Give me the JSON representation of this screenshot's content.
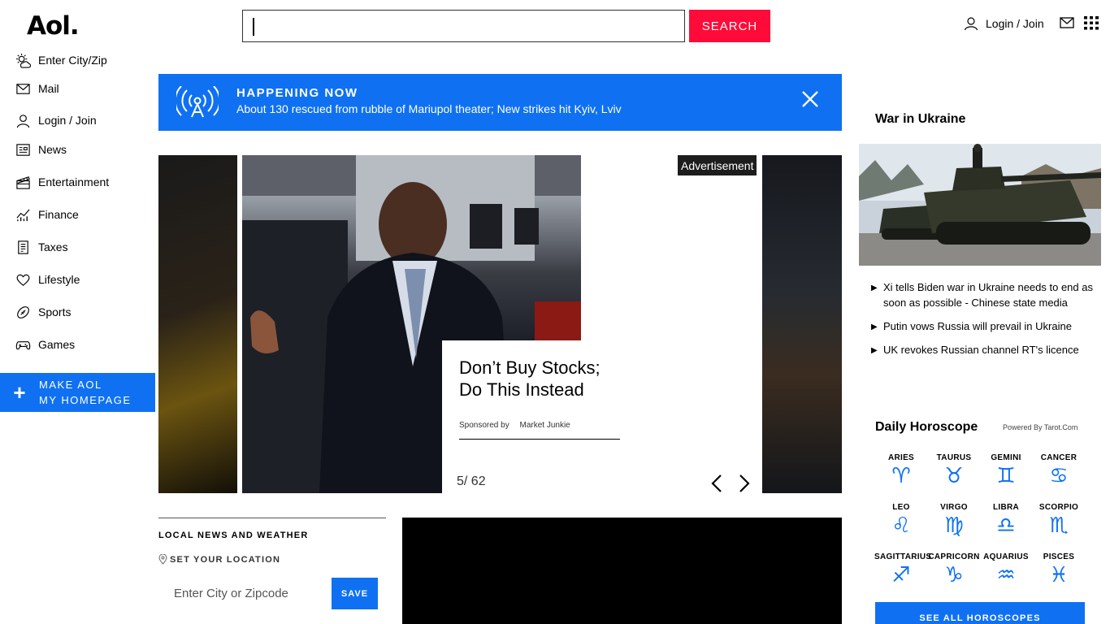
{
  "header": {
    "logo": "Aol.",
    "search_placeholder": "",
    "search_button": "SEARCH",
    "login_label": "Login / Join"
  },
  "nav": {
    "items": [
      {
        "label": "Enter City/Zip",
        "icon": "weather-icon"
      },
      {
        "label": "Mail",
        "icon": "mail-icon"
      },
      {
        "label": "Login / Join",
        "icon": "user-icon"
      },
      {
        "label": "News",
        "icon": "news-icon"
      },
      {
        "label": "Entertainment",
        "icon": "clapperboard-icon"
      },
      {
        "label": "Finance",
        "icon": "chart-icon"
      },
      {
        "label": "Taxes",
        "icon": "document-icon"
      },
      {
        "label": "Lifestyle",
        "icon": "heart-icon"
      },
      {
        "label": "Sports",
        "icon": "football-icon"
      },
      {
        "label": "Games",
        "icon": "gamepad-icon"
      }
    ],
    "make_home_line1": "Make AOL",
    "make_home_line2": "My Homepage"
  },
  "happening_now": {
    "title": "HAPPENING NOW",
    "text": "About 130 rescued from rubble of Mariupol theater; New strikes hit Kyiv, Lviv"
  },
  "slideshow": {
    "ad_label": "Advertisement",
    "headline_line1": "Don’t Buy Stocks;",
    "headline_line2": "Do This Instead",
    "sponsored_by": "Sponsored by",
    "sponsor": "Market Junkie",
    "counter": "5/ 62"
  },
  "local_news": {
    "title": "LOCAL NEWS AND WEATHER",
    "set_location": "SET YOUR LOCATION",
    "input_placeholder": "Enter City or Zipcode",
    "save": "SAVE"
  },
  "ukraine": {
    "title": "War in Ukraine",
    "items": [
      "Xi tells Biden war in Ukraine needs to end as soon as possible - Chinese state media",
      "Putin vows Russia will prevail in Ukraine",
      "UK revokes Russian channel RT's licence"
    ]
  },
  "horoscope": {
    "title": "Daily Horoscope",
    "powered": "Powered By Tarot.Com",
    "signs": [
      {
        "name": "ARIES",
        "glyph": "♈"
      },
      {
        "name": "TAURUS",
        "glyph": "♉"
      },
      {
        "name": "GEMINI",
        "glyph": "♊"
      },
      {
        "name": "CANCER",
        "glyph": "♋"
      },
      {
        "name": "LEO",
        "glyph": "♌"
      },
      {
        "name": "VIRGO",
        "glyph": "♍"
      },
      {
        "name": "LIBRA",
        "glyph": "♎"
      },
      {
        "name": "SCORPIO",
        "glyph": "♏"
      },
      {
        "name": "SAGITTARIUS",
        "glyph": "♐"
      },
      {
        "name": "CAPRICORN",
        "glyph": "♑"
      },
      {
        "name": "AQUARIUS",
        "glyph": "♒"
      },
      {
        "name": "PISCES",
        "glyph": "♓"
      }
    ],
    "button": "SEE ALL HOROSCOPES"
  },
  "colors": {
    "accent_blue": "#0f71f2",
    "search_red": "#ff0b3a"
  }
}
